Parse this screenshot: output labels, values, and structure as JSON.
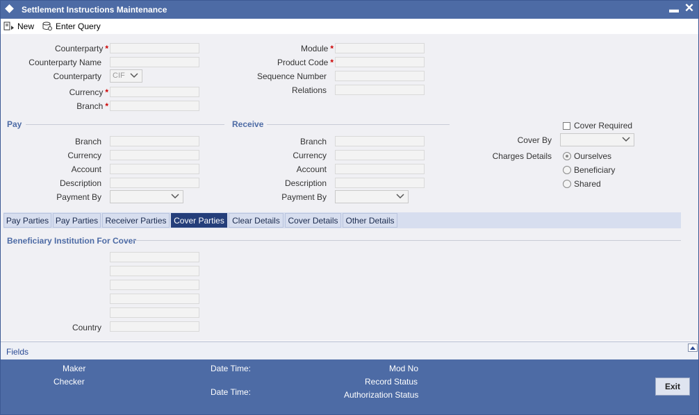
{
  "window": {
    "title": "Settlement Instructions Maintenance"
  },
  "toolbar": {
    "new_label": "New",
    "enter_query_label": "Enter Query"
  },
  "header_fields": {
    "counterparty": "Counterparty",
    "counterparty_name": "Counterparty Name",
    "counterparty_type": "Counterparty",
    "counterparty_type_value": "CIF",
    "currency": "Currency",
    "branch": "Branch",
    "module": "Module",
    "product_code": "Product Code",
    "sequence_number": "Sequence Number",
    "relations": "Relations",
    "required_marker": "*"
  },
  "pay": {
    "title": "Pay",
    "branch": "Branch",
    "currency": "Currency",
    "account": "Account",
    "description": "Description",
    "payment_by": "Payment By"
  },
  "receive": {
    "title": "Receive",
    "branch": "Branch",
    "currency": "Currency",
    "account": "Account",
    "description": "Description",
    "payment_by": "Payment By"
  },
  "cover": {
    "cover_required": "Cover Required",
    "cover_by": "Cover By",
    "charges_details": "Charges Details",
    "options": [
      "Ourselves",
      "Beneficiary",
      "Shared"
    ],
    "selected_option": "Ourselves"
  },
  "tabs": [
    "Pay Parties",
    "Pay Parties",
    "Receiver Parties",
    "Cover Parties",
    "Clear Details",
    "Cover Details",
    "Other Details"
  ],
  "active_tab": "Cover Parties",
  "cover_parties": {
    "section_title": "Beneficiary Institution For Cover",
    "country": "Country"
  },
  "fields_bar": {
    "label": "Fields"
  },
  "footer": {
    "maker": "Maker",
    "checker": "Checker",
    "date_time": "Date Time:",
    "mod_no": "Mod No",
    "record_status": "Record Status",
    "authorization_status": "Authorization Status",
    "exit_label": "Exit"
  },
  "colors": {
    "titlebar": "#4d6ba5",
    "active_tab": "#243e7a",
    "required": "#cc0000"
  }
}
